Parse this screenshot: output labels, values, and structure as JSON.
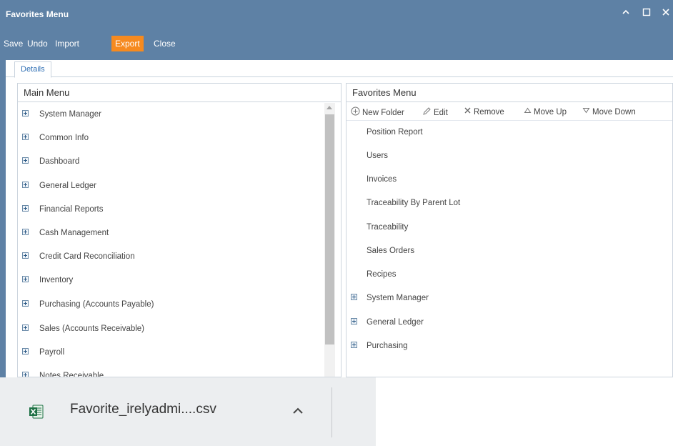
{
  "window": {
    "title": "Favorites Menu",
    "controls": [
      "collapse",
      "maximize",
      "close"
    ]
  },
  "toolbar": {
    "save": "Save",
    "undo": "Undo",
    "import": "Import",
    "export": "Export",
    "close": "Close"
  },
  "tabs": {
    "details": "Details"
  },
  "main_menu": {
    "header": "Main Menu",
    "items": [
      "System Manager",
      "Common Info",
      "Dashboard",
      "General Ledger",
      "Financial Reports",
      "Cash Management",
      "Credit Card Reconciliation",
      "Inventory",
      "Purchasing (Accounts Payable)",
      "Sales (Accounts Receivable)",
      "Payroll",
      "Notes Receivable"
    ]
  },
  "favorites_menu": {
    "header": "Favorites Menu",
    "toolbar": {
      "new_folder": "New Folder",
      "edit": "Edit",
      "remove": "Remove",
      "move_up": "Move Up",
      "move_down": "Move Down"
    },
    "items": [
      "Position Report",
      "Users",
      "Invoices",
      "Traceability By Parent Lot",
      "Traceability",
      "Sales Orders",
      "Recipes"
    ],
    "folders": [
      "System Manager",
      "General Ledger",
      "Purchasing"
    ]
  },
  "download": {
    "filename": "Favorite_irelyadmi....csv"
  },
  "colors": {
    "window_bg": "#5e81a5",
    "export_active": "#f68a1f",
    "tab_text": "#2f6fb4",
    "excel_green": "#1e7145"
  }
}
